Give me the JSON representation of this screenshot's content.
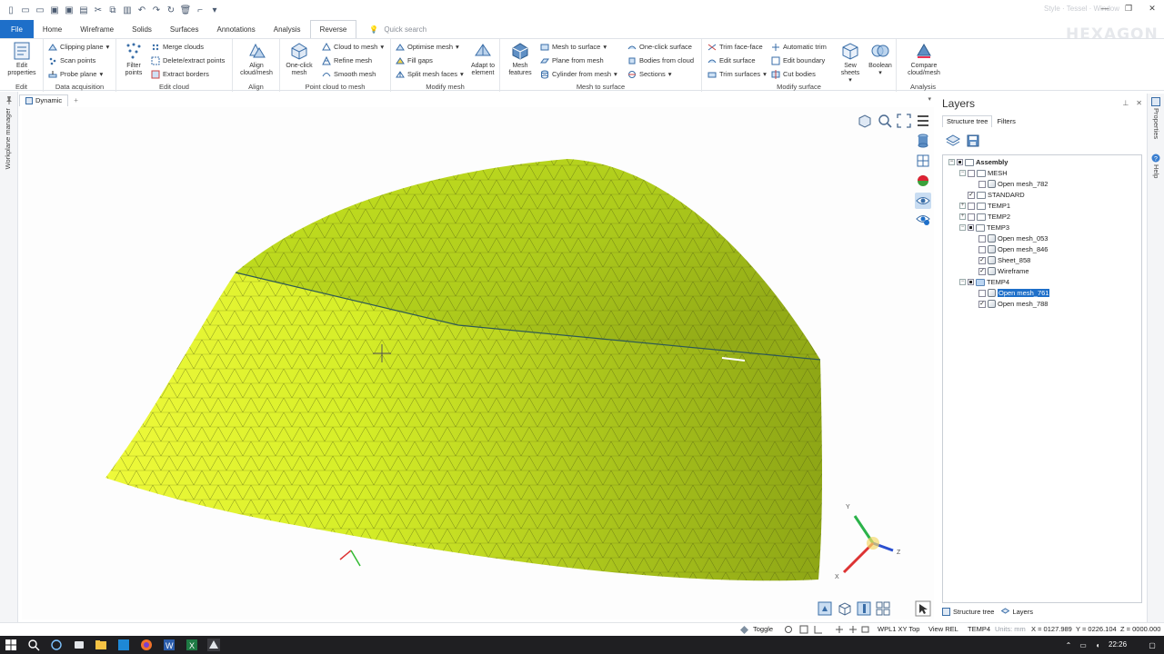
{
  "window": {
    "title": "Style · Tessel · Window",
    "brand": "HEXAGON",
    "controls": [
      "—",
      "❐",
      "✕"
    ]
  },
  "menu": {
    "tabs": [
      "File",
      "Home",
      "Wireframe",
      "Solids",
      "Surfaces",
      "Annotations",
      "Analysis",
      "Reverse"
    ],
    "active": "Reverse",
    "search_placeholder": "Quick search"
  },
  "ribbon": {
    "edit": {
      "label": "Edit",
      "button": "Edit properties"
    },
    "data_acquisition": {
      "label": "Data acquisition",
      "items": [
        "Clipping plane",
        "Scan points",
        "Probe plane"
      ]
    },
    "edit_cloud": {
      "label": "Edit cloud",
      "big": "Filter points",
      "items": [
        "Merge clouds",
        "Delete/extract points",
        "Extract borders"
      ]
    },
    "align": {
      "label": "Align",
      "button": "Align cloud/mesh"
    },
    "point_cloud_to_mesh": {
      "label": "Point cloud to mesh",
      "big": "One-click mesh",
      "items": [
        "Cloud to mesh",
        "Refine mesh",
        "Smooth mesh"
      ]
    },
    "modify_mesh": {
      "label": "Modify mesh",
      "items": [
        "Optimise mesh",
        "Fill gaps",
        "Split mesh faces"
      ],
      "big": "Adapt to element"
    },
    "mesh_to_surface": {
      "label": "Mesh to surface",
      "big": "Mesh features",
      "items": [
        "Mesh to surface",
        "Plane from mesh",
        "Cylinder from mesh",
        "One-click surface",
        "Bodies from cloud",
        "Sections"
      ]
    },
    "modify_surface": {
      "label": "Modify surface",
      "items": [
        "Trim face-face",
        "Edit surface",
        "Trim surfaces",
        "Automatic trim",
        "Edit boundary",
        "Cut bodies"
      ],
      "big1": "Sew sheets",
      "big2": "Boolean"
    },
    "analysis": {
      "label": "Analysis",
      "button": "Compare cloud/mesh"
    }
  },
  "left_strip": {
    "label": "Workplane manager"
  },
  "viewport": {
    "tab": "Dynamic"
  },
  "layers": {
    "title": "Layers",
    "tabs": [
      "Structure tree",
      "Filters"
    ],
    "tree": [
      {
        "label": "Assembly",
        "level": 0,
        "bold": true,
        "kind": "folder",
        "check": "tri",
        "exp": "−"
      },
      {
        "label": "MESH",
        "level": 1,
        "kind": "folder",
        "check": "",
        "exp": "−"
      },
      {
        "label": "Open mesh_782",
        "level": 2,
        "kind": "mesh",
        "check": ""
      },
      {
        "label": "STANDARD",
        "level": 1,
        "kind": "folder",
        "check": "✓"
      },
      {
        "label": "TEMP1",
        "level": 1,
        "kind": "folder",
        "check": "",
        "exp": "+"
      },
      {
        "label": "TEMP2",
        "level": 1,
        "kind": "folder",
        "check": "",
        "exp": "+"
      },
      {
        "label": "TEMP3",
        "level": 1,
        "kind": "folder",
        "check": "tri",
        "exp": "−"
      },
      {
        "label": "Open mesh_053",
        "level": 2,
        "kind": "mesh",
        "check": ""
      },
      {
        "label": "Open mesh_846",
        "level": 2,
        "kind": "mesh",
        "check": ""
      },
      {
        "label": "Sheet_858",
        "level": 2,
        "kind": "mesh",
        "check": "✓"
      },
      {
        "label": "Wireframe",
        "level": 2,
        "kind": "mesh",
        "check": "✓"
      },
      {
        "label": "TEMP4",
        "level": 1,
        "kind": "folder-blue",
        "check": "tri",
        "exp": "−"
      },
      {
        "label": "Open mesh_761",
        "level": 2,
        "kind": "mesh",
        "check": "",
        "selected": true
      },
      {
        "label": "Open mesh_788",
        "level": 2,
        "kind": "mesh",
        "check": "✓"
      }
    ],
    "bottom_tabs": [
      "Structure tree",
      "Layers"
    ]
  },
  "right_strip": {
    "properties": "Properties",
    "help": "Help"
  },
  "status": {
    "toggle": "Toggle",
    "workplane": "WPL1 XY Top",
    "view": "View REL",
    "layer": "TEMP4",
    "units": "Units: mm",
    "x": "X = 0127.989",
    "y": "Y = 0226.104",
    "z": "Z = 0000.000"
  },
  "taskbar": {
    "clock": "22:26"
  },
  "colors": {
    "accent": "#1e6fc9",
    "mesh_light": "#d9f12a",
    "mesh_dark": "#8fa416"
  }
}
